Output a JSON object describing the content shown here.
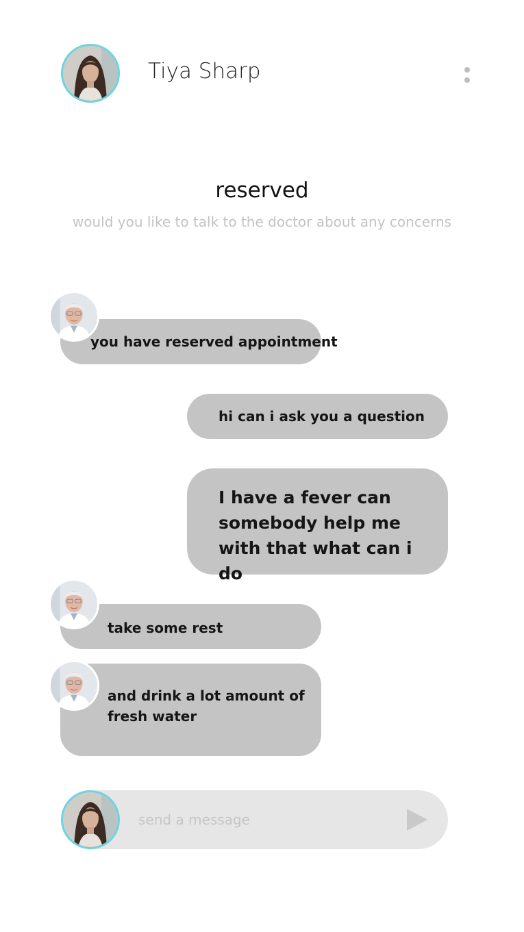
{
  "header": {
    "contact_name": "Tiya Sharp",
    "avatar_icon": "user-avatar",
    "menu_icon": "more-vertical-icon"
  },
  "status": {
    "title": "reserved",
    "subtitle": "would you like to talk to the doctor about any concerns"
  },
  "messages": [
    {
      "sender": "doctor",
      "text": "you have reserved appointment"
    },
    {
      "sender": "user",
      "text": "hi can i ask you a question"
    },
    {
      "sender": "user",
      "text": "I have a fever can somebody help me with that what can i do"
    },
    {
      "sender": "doctor",
      "text": "take some rest"
    },
    {
      "sender": "doctor",
      "text": "and drink a lot amount of fresh water"
    }
  ],
  "composer": {
    "placeholder": "send a message",
    "value": "",
    "send_icon": "send-icon"
  },
  "colors": {
    "bubble": "#c4c4c4",
    "composer": "#e6e6e6",
    "avatar_ring": "#6ed3e0",
    "muted_text": "#c3c3c3",
    "menu_dots": "#bdbdbd"
  }
}
